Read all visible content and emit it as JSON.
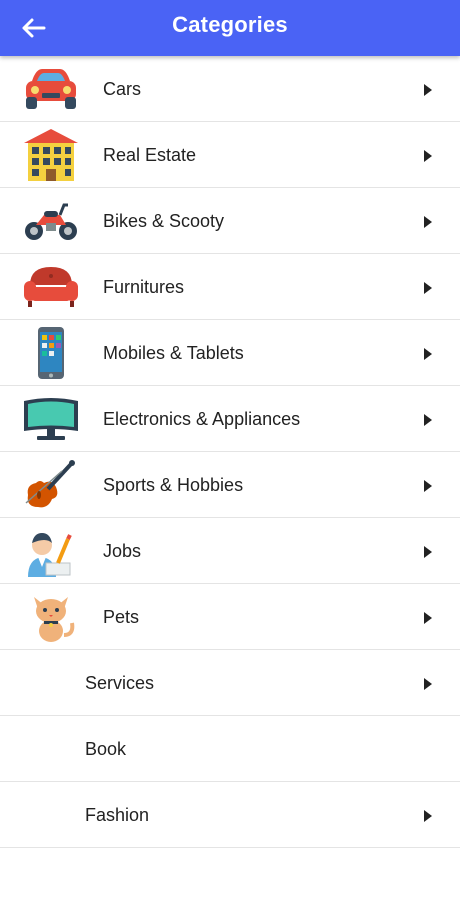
{
  "header": {
    "title": "Categories"
  },
  "categories": [
    {
      "label": "Cars",
      "icon": "car-icon",
      "chevron": true
    },
    {
      "label": "Real Estate",
      "icon": "building-icon",
      "chevron": true
    },
    {
      "label": "Bikes & Scooty",
      "icon": "motorbike-icon",
      "chevron": true
    },
    {
      "label": "Furnitures",
      "icon": "sofa-icon",
      "chevron": true
    },
    {
      "label": "Mobiles & Tablets",
      "icon": "smartphone-icon",
      "chevron": true
    },
    {
      "label": "Electronics & Appliances",
      "icon": "tv-icon",
      "chevron": true
    },
    {
      "label": "Sports & Hobbies",
      "icon": "violin-icon",
      "chevron": true
    },
    {
      "label": "Jobs",
      "icon": "office-worker-icon",
      "chevron": true
    },
    {
      "label": "Pets",
      "icon": "cat-icon",
      "chevron": true
    },
    {
      "label": "Services",
      "icon": null,
      "chevron": true
    },
    {
      "label": "Book",
      "icon": null,
      "chevron": false
    },
    {
      "label": "Fashion",
      "icon": null,
      "chevron": true
    }
  ],
  "colors": {
    "appbar": "#4a63f5",
    "divider": "#e4e4e4",
    "chevron": "#222222"
  }
}
